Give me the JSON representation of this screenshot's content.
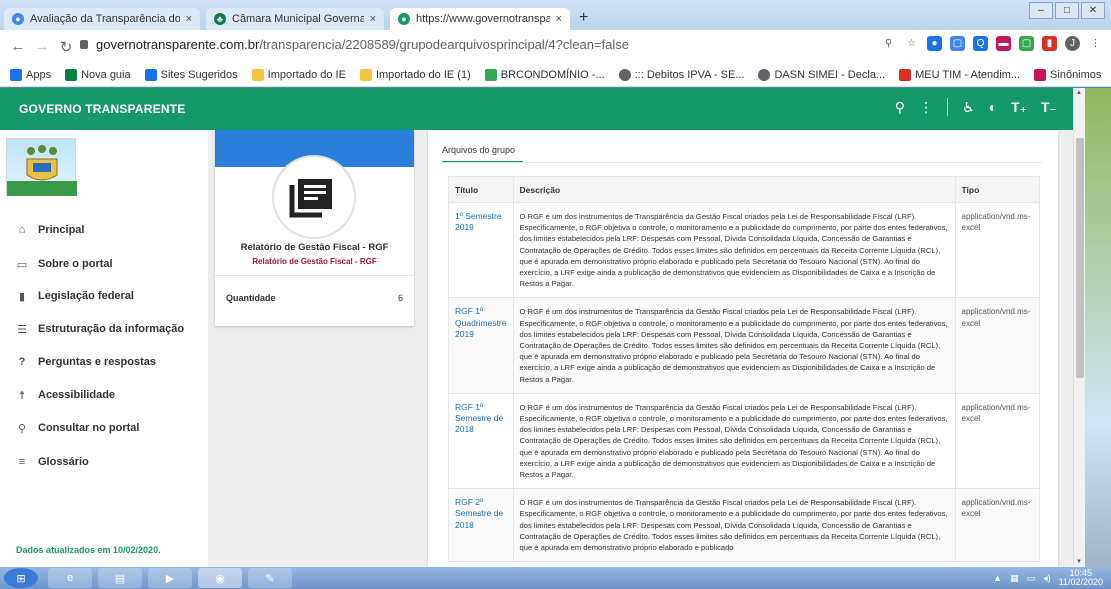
{
  "browser": {
    "tabs": [
      {
        "title": "Avaliação da Transparência dos J",
        "icon": "chrome-icon",
        "active": false
      },
      {
        "title": "Câmara Municipal Governador N",
        "icon": "chamber-icon",
        "active": false
      },
      {
        "title": "https://www.governotransparent",
        "icon": "site-icon",
        "active": true
      }
    ],
    "tab_close": "×",
    "new_tab": "+",
    "url_domain": "governotransparente.com.br",
    "url_path": "/transparencia/2208589/grupodearquivosprincipal/4?clean=false",
    "bookmarks": [
      {
        "label": "Apps",
        "color": "#1a73e8"
      },
      {
        "label": "Nova guia",
        "color": "#0b8043"
      },
      {
        "label": "Sites Sugeridos",
        "color": "#1a73e8"
      },
      {
        "label": "Importado do IE",
        "color": "#f4c542"
      },
      {
        "label": "Importado do IE (1)",
        "color": "#f4c542"
      },
      {
        "label": "BRCONDOMÍNIO -...",
        "color": "#34a853"
      },
      {
        "label": "::: Debitos IPVA - SE...",
        "color": "#5f6368"
      },
      {
        "label": "DASN SIMEI - Decla...",
        "color": "#5f6368"
      },
      {
        "label": "MEU TIM - Atendim...",
        "color": "#d93025"
      },
      {
        "label": "Sinônimos",
        "color": "#c2185b"
      }
    ],
    "bookmarks_more": "»"
  },
  "app": {
    "title": "GOVERNO TRANSPARENTE",
    "accent": "#16996a",
    "nav": [
      {
        "label": "Principal",
        "icon": "home-icon"
      },
      {
        "label": "Sobre o portal",
        "icon": "folder-icon"
      },
      {
        "label": "Legislação federal",
        "icon": "document-icon"
      },
      {
        "label": "Estruturação da informação",
        "icon": "list-icon"
      },
      {
        "label": "Perguntas e respostas",
        "icon": "question-icon"
      },
      {
        "label": "Acessibilidade",
        "icon": "accessibility-icon"
      },
      {
        "label": "Consultar no portal",
        "icon": "search-icon"
      },
      {
        "label": "Glossário",
        "icon": "glossary-icon"
      }
    ],
    "updated": "Dados atualizados em 10/02/2020."
  },
  "card": {
    "title": "Relatório de Gestão Fiscal - RGF",
    "subtitle": "Relatório de Gestão Fiscal - RGF",
    "quantity_label": "Quantidade",
    "quantity_value": "6"
  },
  "panel": {
    "tab": "Arquivos do grupo",
    "headers": [
      "Título",
      "Descrição",
      "Tipo"
    ],
    "rows": [
      {
        "title": "1º Semestre 2019",
        "desc": "O RGF é um dos instrumentos de Transparência da Gestão Fiscal criados pela Lei de Responsabilidade Fiscal (LRF). Especificamente, o RGF objetiva o controle, o monitoramento e a publicidade do cumprimento, por parte dos entes federativos, dos limites estabelecidos pela LRF: Despesas com Pessoal, Dívida Consolidada Líquida, Concessão de Garantias e Contratação de Operações de Crédito. Todos esses limites são definidos em percentuais da Receita Corrente Líquida (RCL), que é apurada em demonstrativo próprio elaborado e publicado pela Secretaria do Tesouro Nacional (STN). Ao final do exercício, a LRF exige ainda a publicação de demonstrativos que evidenciem as Disponibilidades de Caixa e a Inscrição de Restos a Pagar.",
        "type": "application/vnd.ms-excel"
      },
      {
        "title": "RGF 1º Quadrimestre 2019",
        "desc": "O RGF é um dos instrumentos de Transparência da Gestão Fiscal criados pela Lei de Responsabilidade Fiscal (LRF). Especificamente, o RGF objetiva o controle, o monitoramento e a publicidade do cumprimento, por parte dos entes federativos, dos limites estabelecidos pela LRF: Despesas com Pessoal, Dívida Consolidada Líquida, Concessão de Garantias e Contratação de Operações de Crédito. Todos esses limites são definidos em percentuais da Receita Corrente Líquida (RCL), que é apurada em demonstrativo próprio elaborado e publicado pela Secretaria do Tesouro Nacional (STN). Ao final do exercício, a LRF exige ainda a publicação de demonstrativos que evidenciem as Disponibilidades de Caixa e a Inscrição de Restos a Pagar.",
        "type": "application/vnd.ms-excel"
      },
      {
        "title": "RGF 1º Semestre de 2018",
        "desc": "O RGF é um dos instrumentos de Transparência da Gestão Fiscal criados pela Lei de Responsabilidade Fiscal (LRF). Especificamente, o RGF objetiva o controle, o monitoramento e a publicidade do cumprimento, por parte dos entes federativos, dos limites estabelecidos pela LRF: Despesas com Pessoal, Dívida Consolidada Líquida, Concessão de Garantias e Contratação de Operações de Crédito. Todos esses limites são definidos em percentuais da Receita Corrente Líquida (RCL), que é apurada em demonstrativo próprio elaborado e publicado pela Secretaria do Tesouro Nacional (STN). Ao final do exercício, a LRF exige ainda a publicação de demonstrativos que evidenciem as Disponibilidades de Caixa e a Inscrição de Restos a Pagar.",
        "type": "application/vnd.ms-excel"
      },
      {
        "title": "RGF 2º Semestre de 2018",
        "desc": "O RGF é um dos instrumentos de Transparência da Gestão Fiscal criados pela Lei de Responsabilidade Fiscal (LRF). Especificamente, o RGF objetiva o controle, o monitoramento e a publicidade do cumprimento, por parte dos entes federativos, dos limites estabelecidos pela LRF: Despesas com Pessoal, Dívida Consolidada Líquida, Concessão de Garantias e Contratação de Operações de Crédito. Todos esses limites são definidos em percentuais da Receita Corrente Líquida (RCL), que é apurada em demonstrativo próprio elaborado e publicado",
        "type": "application/vnd.ms-excel"
      }
    ]
  },
  "taskbar": {
    "time": "10:45",
    "date": "11/02/2020"
  }
}
